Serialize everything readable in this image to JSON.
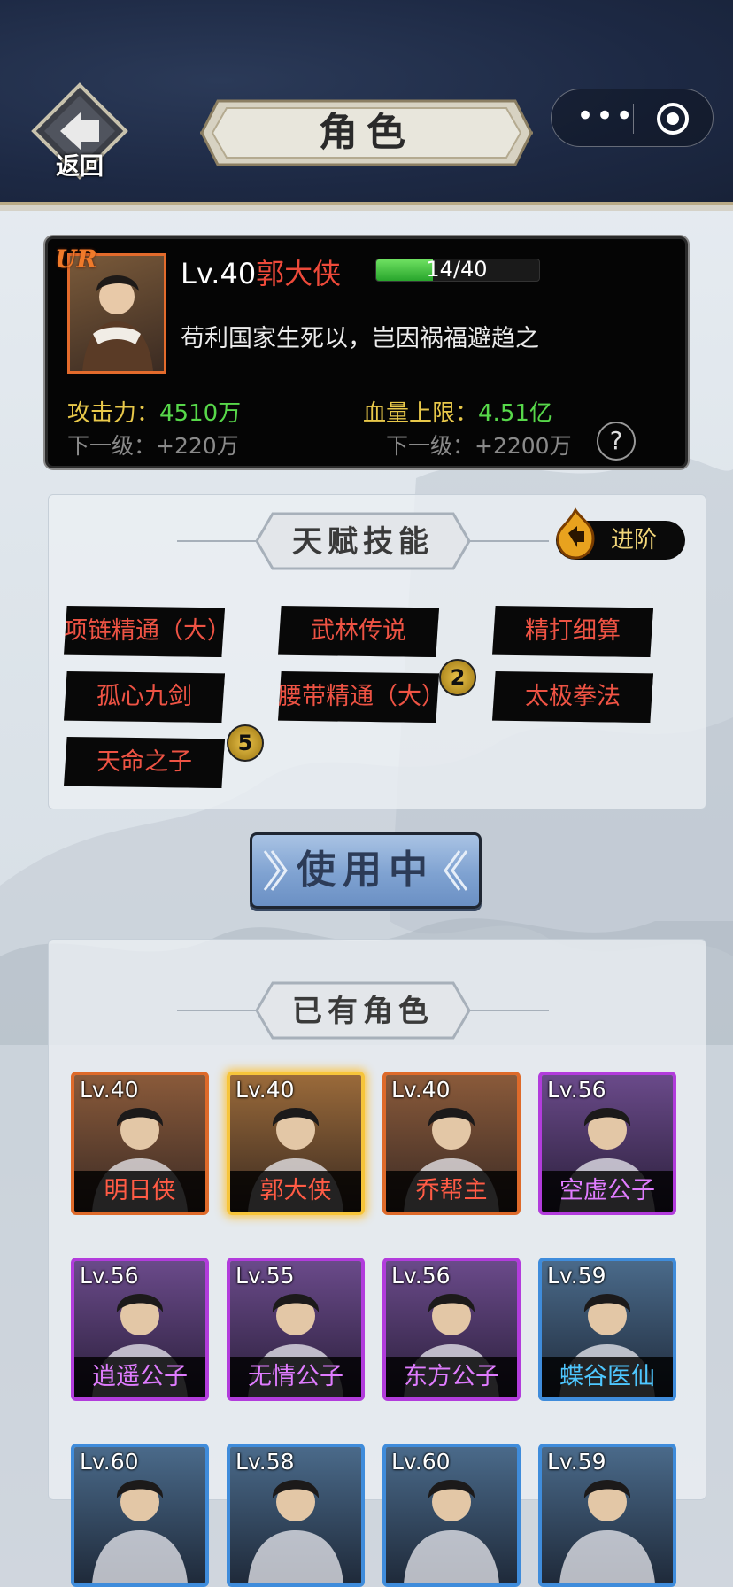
{
  "header": {
    "back_label": "返回",
    "title": "角色",
    "capsule_menu_icon": "more-dots-icon",
    "capsule_close_icon": "target-circle-icon"
  },
  "hero": {
    "rarity": "UR",
    "level": "Lv.40",
    "name": "郭大侠",
    "exp_text": "14/40",
    "exp_fraction": 0.35,
    "quote": "苟利国家生死以，岂因祸福避趋之",
    "attack_label": "攻击力：",
    "attack_value": "4510万",
    "hp_label": "血量上限：",
    "hp_value": "4.51亿",
    "attack_next": "下一级：+220万",
    "hp_next": "下一级：+2200万",
    "help_label": "?"
  },
  "talent": {
    "title": "天赋技能",
    "advance_label": "进阶",
    "skills": [
      {
        "name": "项链精通（大）",
        "badge": ""
      },
      {
        "name": "武林传说",
        "badge": ""
      },
      {
        "name": "精打细算",
        "badge": ""
      },
      {
        "name": "孤心九剑",
        "badge": ""
      },
      {
        "name": "腰带精通（大）",
        "badge": "2"
      },
      {
        "name": "太极拳法",
        "badge": ""
      },
      {
        "name": "天命之子",
        "badge": "5"
      }
    ]
  },
  "use_button": "使用中",
  "roster": {
    "title": "已有角色",
    "characters": [
      {
        "level": "Lv.40",
        "name": "明日侠",
        "rarity": "orange",
        "color": "#de6a2a"
      },
      {
        "level": "Lv.40",
        "name": "郭大侠",
        "rarity": "gold",
        "color": "#f7c53a"
      },
      {
        "level": "Lv.40",
        "name": "乔帮主",
        "rarity": "orange",
        "color": "#de6a2a"
      },
      {
        "level": "Lv.56",
        "name": "空虚公子",
        "rarity": "purple",
        "color": "#b23cdc"
      },
      {
        "level": "Lv.56",
        "name": "逍遥公子",
        "rarity": "purple",
        "color": "#b23cdc"
      },
      {
        "level": "Lv.55",
        "name": "无情公子",
        "rarity": "purple",
        "color": "#b23cdc"
      },
      {
        "level": "Lv.56",
        "name": "东方公子",
        "rarity": "purple",
        "color": "#b23cdc"
      },
      {
        "level": "Lv.59",
        "name": "蝶谷医仙",
        "rarity": "blue",
        "color": "#3f8cdb"
      },
      {
        "level": "Lv.60",
        "name": "",
        "rarity": "blue",
        "color": "#3f8cdb"
      },
      {
        "level": "Lv.58",
        "name": "",
        "rarity": "blue",
        "color": "#3f8cdb"
      },
      {
        "level": "Lv.60",
        "name": "",
        "rarity": "blue",
        "color": "#3f8cdb"
      },
      {
        "level": "Lv.59",
        "name": "",
        "rarity": "blue",
        "color": "#3f8cdb"
      }
    ]
  }
}
